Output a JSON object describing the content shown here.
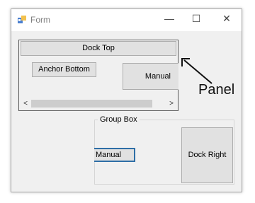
{
  "window": {
    "title": "Form",
    "icon": "form-app-icon",
    "controls": {
      "minimize": "—",
      "maximize": "☐",
      "close": "✕"
    }
  },
  "panel": {
    "dock_top": "Dock Top",
    "anchor_bottom": "Anchor Bottom",
    "manual": "Manual",
    "scrollbar": {
      "left": "<",
      "right": ">"
    }
  },
  "group_box": {
    "caption": "Group Box",
    "manual": "Manual",
    "dock_right": "Dock Right"
  },
  "annotation": {
    "label": "Panel"
  },
  "colors": {
    "window_bg": "#f0f0f0",
    "button_bg": "#e1e1e1",
    "focus_border": "#2e6ea6"
  }
}
